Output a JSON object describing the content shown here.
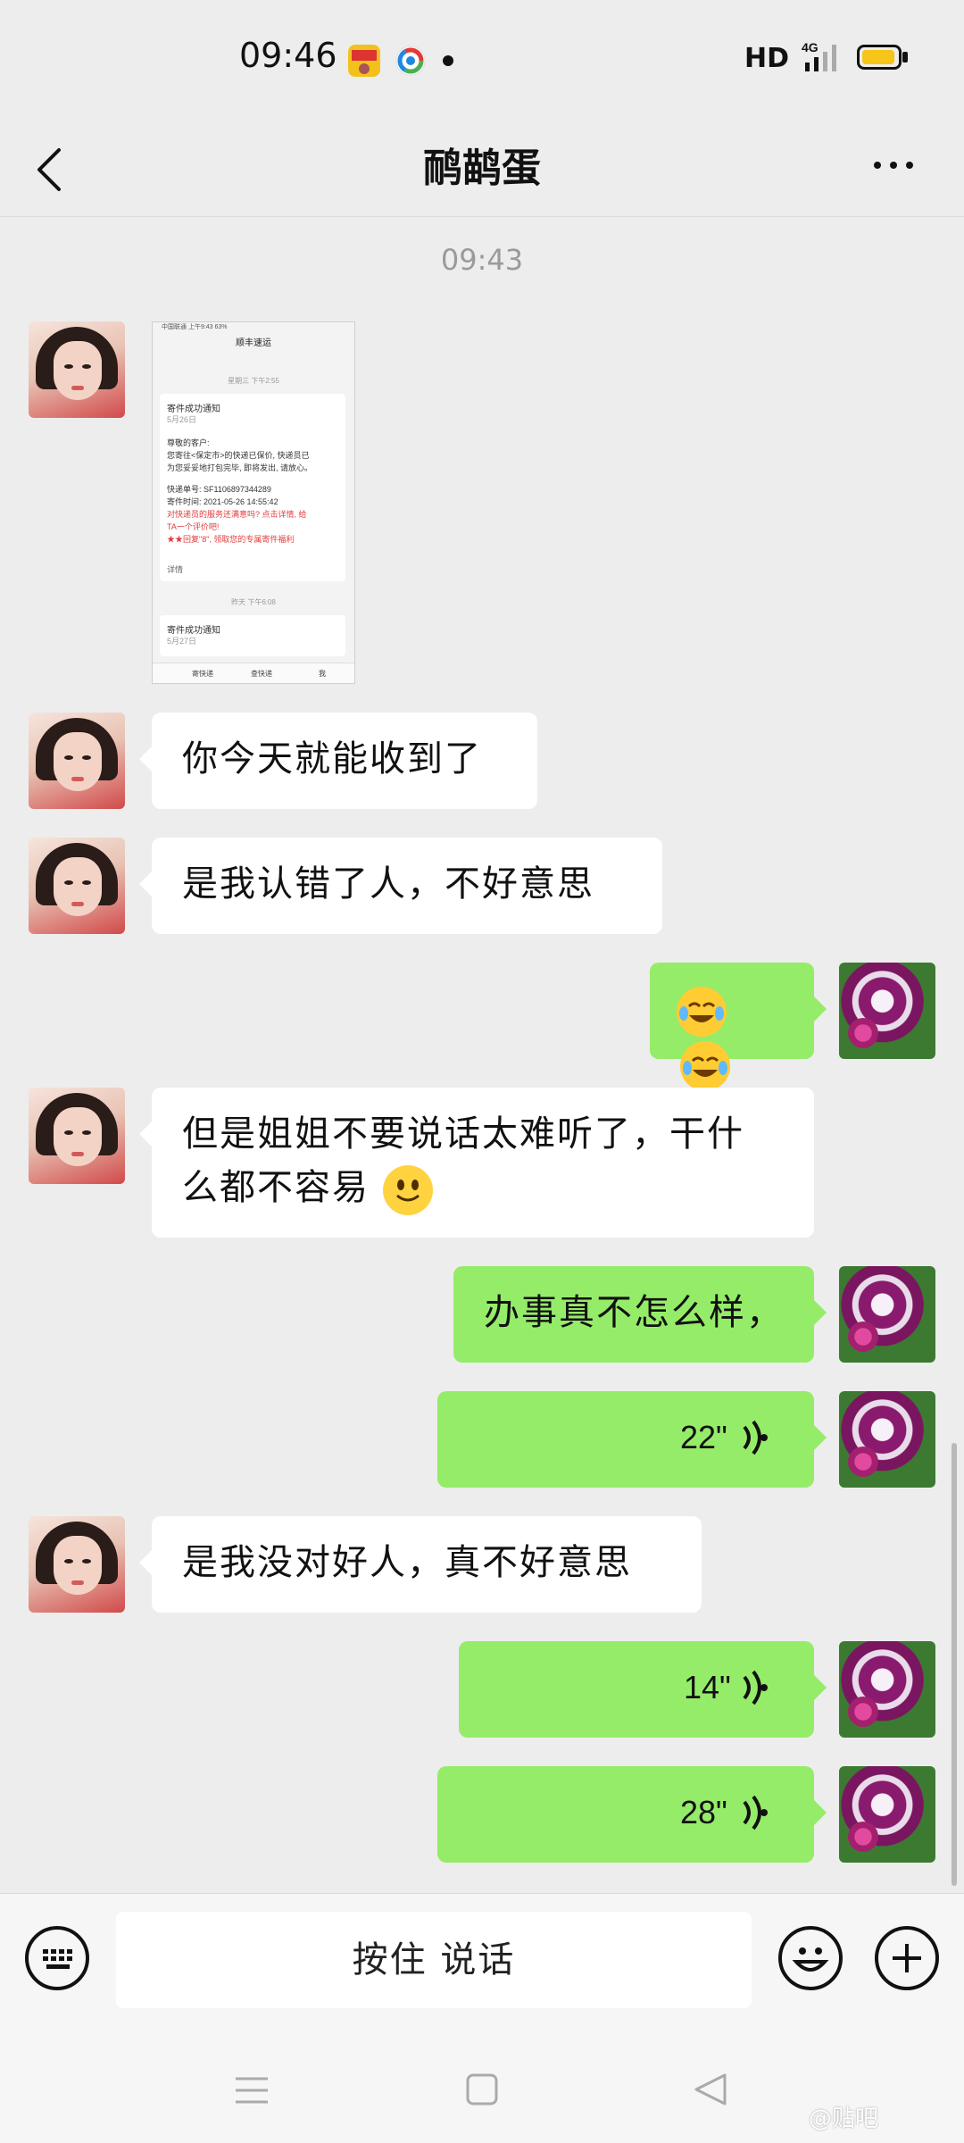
{
  "status_bar": {
    "time": "09:46",
    "hd_label": "HD",
    "network_label": "4G",
    "icons": [
      "app-notification-icon",
      "chrome-like-icon",
      "dot-icon",
      "signal-icon",
      "battery-icon"
    ],
    "battery_color": "#f5c518"
  },
  "header": {
    "contact_name": "鸸鹋蛋",
    "back_icon": "chevron-left-icon",
    "more_icon": "more-horizontal-icon"
  },
  "timestamp": "09:43",
  "shared_image": {
    "status_text": "中国联通  上午9:43  63%",
    "title": "顺丰速运",
    "date1": "星期三 下午2:55",
    "card_title": "寄件成功通知",
    "card_date": "5月26日",
    "card_lines": [
      "尊敬的客户:",
      "您寄往<保定市>的快递已保价, 快递员已",
      "为您妥妥地打包完毕, 即将发出, 请放心。",
      "快递单号:   SF1106897344289",
      "寄件时间:   2021-05-26 14:55:42"
    ],
    "card_red_lines": [
      "对快递员的服务还满意吗? 点击详情, 给",
      "TA一个评价吧!",
      "★★回复\"8\", 领取您的专属寄件福利"
    ],
    "detail_label": "详情",
    "date2": "昨天 下午6:08",
    "card2_title": "寄件成功通知",
    "card2_date": "5月27日",
    "tabs": [
      "寄快递",
      "查快递",
      "我"
    ]
  },
  "messages": [
    {
      "side": "in",
      "type": "image"
    },
    {
      "side": "in",
      "type": "text",
      "text": "你今天就能收到了"
    },
    {
      "side": "in",
      "type": "text",
      "text": "是我认错了人，不好意思"
    },
    {
      "side": "out",
      "type": "emoji",
      "emoji": [
        "laughing-crying-emoji",
        "laughing-crying-emoji"
      ]
    },
    {
      "side": "in",
      "type": "text",
      "lines": [
        "但是姐姐不要说话太难听了，干什",
        "么都不容易"
      ],
      "emoji": "smile-emoji"
    },
    {
      "side": "out",
      "type": "text",
      "text": "办事真不怎么样，"
    },
    {
      "side": "out",
      "type": "voice",
      "duration": "22\""
    },
    {
      "side": "in",
      "type": "text",
      "text": "是我没对好人，真不好意思"
    },
    {
      "side": "out",
      "type": "voice",
      "duration": "14\""
    },
    {
      "side": "out",
      "type": "voice",
      "duration": "28\""
    }
  ],
  "input_bar": {
    "hold_to_talk": "按住 说话",
    "keyboard_icon": "keyboard-icon",
    "emoji_icon": "smiley-icon",
    "plus_icon": "plus-circle-icon"
  },
  "nav_bar": {
    "icons": [
      "menu-icon",
      "home-square-icon",
      "back-triangle-icon"
    ]
  },
  "watermark": "@贴吧",
  "colors": {
    "background": "#ededed",
    "bubble_out": "#95ec69",
    "bubble_in": "#ffffff"
  }
}
